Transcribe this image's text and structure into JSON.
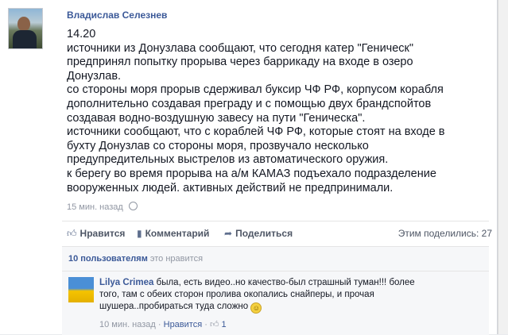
{
  "post": {
    "author": "Владислав Селезнев",
    "lines": [
      "14.20",
      "источники из Донузлава сообщают, что сегодня катер \"Геническ\"",
      "предпринял попытку прорыва через баррикаду на входе в озеро",
      "Донузлав.",
      "со стороны моря прорыв сдерживал буксир ЧФ РФ, корпусом корабля",
      "дополнительно создавая преграду и с помощью двух брандспойтов",
      "создавая водно-воздушную завесу на пути \"Геническа\".",
      "источники сообщают, что с кораблей ЧФ РФ, которые стоят на входе в",
      "бухту Донузлав со стороны моря, прозвучало несколько",
      "предупредительных выстрелов из автоматического оружия.",
      "к берегу во время прорыва на а/м КАМАЗ подъехало подразделение",
      "вооруженных людей. активных действий не предпринимали."
    ],
    "time": "15 мин. назад"
  },
  "actions": {
    "like": "Нравится",
    "comment": "Комментарий",
    "share": "Поделиться",
    "shares_count": "Этим поделились: 27"
  },
  "likes": {
    "count": "10 пользователям",
    "suffix": "это нравится"
  },
  "comment": {
    "author": "Lilya Crimea",
    "text": "была, есть видео..но качество-был страшный туман!!! более",
    "text2": "того, там с обеих сторон пролива окопались снайперы, и прочая",
    "text3": "шушера..пробираться туда сложно",
    "time": "10 мин. назад",
    "like": "Нравится",
    "likes": "1"
  },
  "colors": {
    "link": "#3b5998",
    "muted": "#9197a3",
    "text": "#141823"
  },
  "icons": [
    "globe-icon",
    "thumbs-up-icon",
    "comment-icon",
    "share-arrow-icon",
    "smiley-icon"
  ]
}
